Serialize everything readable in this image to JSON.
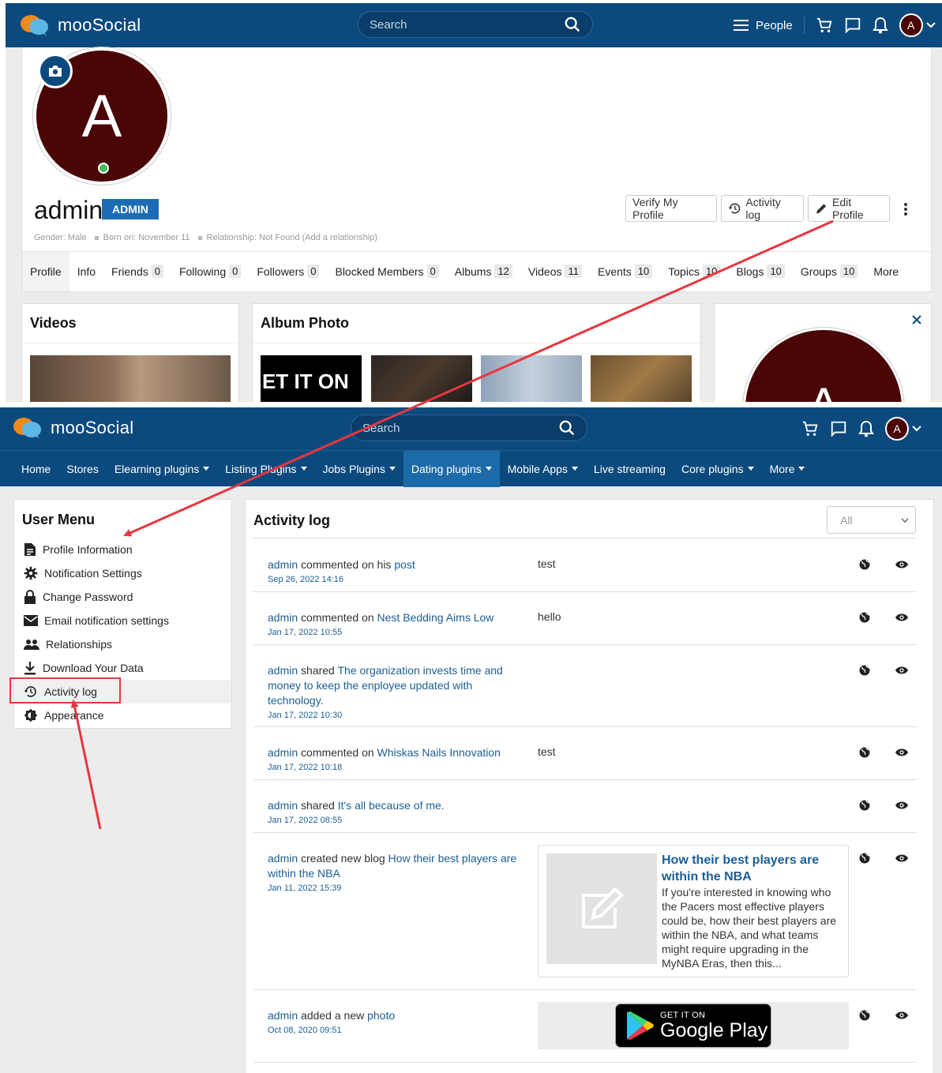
{
  "top": {
    "brand": "mooSocial",
    "search_placeholder": "Search",
    "people_label": "People",
    "avatar_letter": "A",
    "profile": {
      "avatar_letter": "A",
      "username": "admin",
      "role_badge": "ADMIN",
      "buttons": {
        "verify": "Verify My Profile",
        "activity": "Activity log",
        "edit": "Edit Profile"
      },
      "meta": {
        "gender": "Gender: Male",
        "born": "Born on: November 11",
        "relationship": "Relationship: Not Found (Add a relationship)"
      }
    },
    "tabs": [
      {
        "label": "Profile",
        "count": ""
      },
      {
        "label": "Info",
        "count": ""
      },
      {
        "label": "Friends",
        "count": "0"
      },
      {
        "label": "Following",
        "count": "0"
      },
      {
        "label": "Followers",
        "count": "0"
      },
      {
        "label": "Blocked Members",
        "count": "0"
      },
      {
        "label": "Albums",
        "count": "12"
      },
      {
        "label": "Videos",
        "count": "11"
      },
      {
        "label": "Events",
        "count": "10"
      },
      {
        "label": "Topics",
        "count": "10"
      },
      {
        "label": "Blogs",
        "count": "10"
      },
      {
        "label": "Groups",
        "count": "10"
      },
      {
        "label": "More",
        "count": ""
      }
    ],
    "videos_title": "Videos",
    "album_title": "Album Photo",
    "album_thumb_text": "ET IT ON",
    "right_avatar_letter": "A"
  },
  "bottom": {
    "brand": "mooSocial",
    "search_placeholder": "Search",
    "avatar_letter": "A",
    "nav": [
      {
        "label": "Home",
        "caret": false
      },
      {
        "label": "Stores",
        "caret": false
      },
      {
        "label": "Elearning plugins",
        "caret": true
      },
      {
        "label": "Listing Plugins",
        "caret": true
      },
      {
        "label": "Jobs Plugins",
        "caret": true
      },
      {
        "label": "Dating plugins",
        "caret": true
      },
      {
        "label": "Mobile Apps",
        "caret": true
      },
      {
        "label": "Live streaming",
        "caret": false
      },
      {
        "label": "Core plugins",
        "caret": true
      },
      {
        "label": "More",
        "caret": true
      }
    ],
    "user_menu": {
      "title": "User Menu",
      "items": [
        {
          "label": "Profile Information",
          "icon": "document-icon"
        },
        {
          "label": "Notification Settings",
          "icon": "gear-icon"
        },
        {
          "label": "Change Password",
          "icon": "lock-icon"
        },
        {
          "label": "Email notification settings",
          "icon": "mail-icon"
        },
        {
          "label": "Relationships",
          "icon": "people-icon"
        },
        {
          "label": "Download Your Data",
          "icon": "download-icon"
        },
        {
          "label": "Activity log",
          "icon": "history-icon"
        },
        {
          "label": "Appearance",
          "icon": "brightness-icon"
        }
      ]
    },
    "activity": {
      "title": "Activity log",
      "filter": "All",
      "rows": [
        {
          "actor": "admin",
          "verb": " commented on his ",
          "link": "post",
          "date": "Sep 26, 2022 14:16",
          "extra": "test"
        },
        {
          "actor": "admin",
          "verb": " commented on ",
          "link": "Nest Bedding Aims Low",
          "date": "Jan 17, 2022 10:55",
          "extra": "hello"
        },
        {
          "actor": "admin",
          "verb": " shared ",
          "link": "The organization invests time and money to keep the enployee updated with technology.",
          "date": "Jan 17, 2022 10:30",
          "extra": ""
        },
        {
          "actor": "admin",
          "verb": " commented on ",
          "link": "Whiskas Nails Innovation",
          "date": "Jan 17, 2022 10:18",
          "extra": "test"
        },
        {
          "actor": "admin",
          "verb": " shared ",
          "link": "It's all because of me.",
          "date": "Jan 17, 2022 08:55",
          "extra": ""
        },
        {
          "actor": "admin",
          "verb": " created new blog ",
          "link": "How their best players are within the NBA",
          "date": "Jan 11, 2022 15:39",
          "extra": ""
        },
        {
          "actor": "admin",
          "verb": " added a new ",
          "link": "photo",
          "date": "Oct 08, 2020 09:51",
          "extra": ""
        }
      ],
      "blog_card": {
        "title": "How their best players are within the NBA",
        "excerpt": "If you're interested in knowing who the Pacers most effective players could be, how their best players are within the NBA, and what teams might require upgrading in the MyNBA Eras, then this..."
      },
      "google_play": {
        "top": "GET IT ON",
        "bottom": "Google Play"
      }
    }
  },
  "colors": {
    "header": "#0c4a7e",
    "link": "#1b5e95",
    "annotation": "#e8363f",
    "avatar": "#4a0505"
  }
}
